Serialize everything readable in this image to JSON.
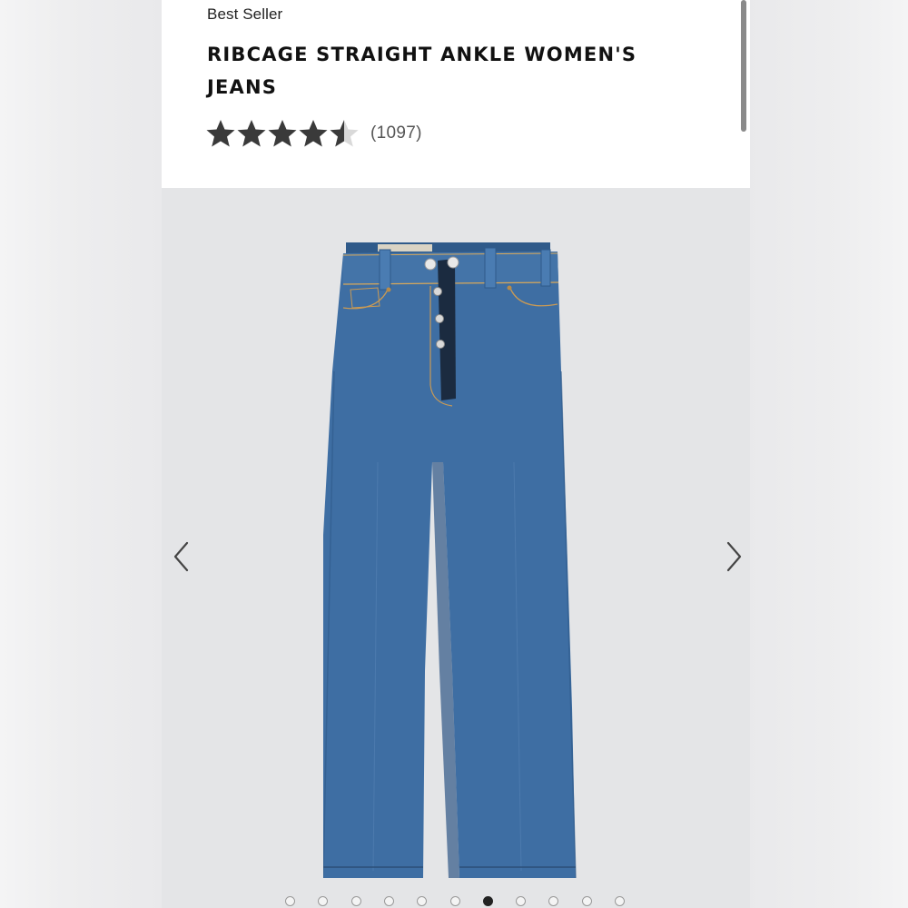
{
  "product": {
    "badge": "Best Seller",
    "title_line1": "RIBCAGE STRAIGHT ANKLE WOMEN'S",
    "title_line2": "JEANS",
    "rating": 4.5,
    "rating_max": 5,
    "review_count": "(1097)"
  },
  "gallery": {
    "image_alt": "Ribcage straight ankle women's jeans, medium blue wash",
    "prev_icon": "chevron-left-icon",
    "next_icon": "chevron-right-icon",
    "dot_count": 11,
    "active_dot_index": 6
  },
  "colors": {
    "star_filled": "#3a3a3a",
    "star_empty": "#d9d9d9",
    "denim": "#3e6ea3"
  }
}
